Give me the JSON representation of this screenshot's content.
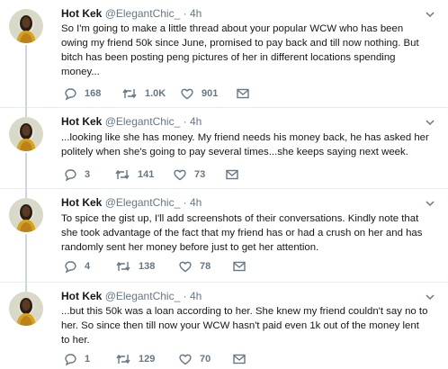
{
  "tweets": [
    {
      "name": "Hot Kek",
      "handle": "@ElegantChic_",
      "separator": "·",
      "time": "4h",
      "lines": [
        "So I'm going to make a little thread about your popular WCW who has been",
        "owing my friend 50k since June, promised to pay back and till now nothing. But",
        "bitch has been posting peng pictures of her in different locations spending",
        "money..."
      ],
      "replies": "168",
      "retweets": "1.0K",
      "likes": "901"
    },
    {
      "name": "Hot Kek",
      "handle": "@ElegantChic_",
      "separator": "·",
      "time": "4h",
      "lines": [
        "...looking like she has money. My friend needs his money back, he has asked her",
        "politely when she's going to pay several times...she keeps saying next week."
      ],
      "replies": "3",
      "retweets": "141",
      "likes": "73"
    },
    {
      "name": "Hot Kek",
      "handle": "@ElegantChic_",
      "separator": "·",
      "time": "4h",
      "lines": [
        "To spice the gist up, I'll add screenshots of their conversations. Kindly note that",
        "she took advantage of the fact that my friend has or had a crush on her and has",
        "randomly sent her money before just to get her attention."
      ],
      "replies": "4",
      "retweets": "138",
      "likes": "78"
    },
    {
      "name": "Hot Kek",
      "handle": "@ElegantChic_",
      "separator": "·",
      "time": "4h",
      "lines": [
        "...but this 50k was a loan according to her. She knew my friend couldn't say no to",
        "her. So since then till now your WCW hasn't paid even 1k out of the money lent",
        "to her."
      ],
      "replies": "1",
      "retweets": "129",
      "likes": "70"
    }
  ],
  "icons": {
    "reply": "reply-icon",
    "retweet": "retweet-icon",
    "like": "heart-icon",
    "dm": "envelope-icon",
    "menu": "chevron-down-icon"
  },
  "colors": {
    "text": "#14171a",
    "muted": "#657786",
    "divider": "#e6ecf0",
    "thread_line": "#ccd6dd",
    "accent": "#1da1f2"
  }
}
